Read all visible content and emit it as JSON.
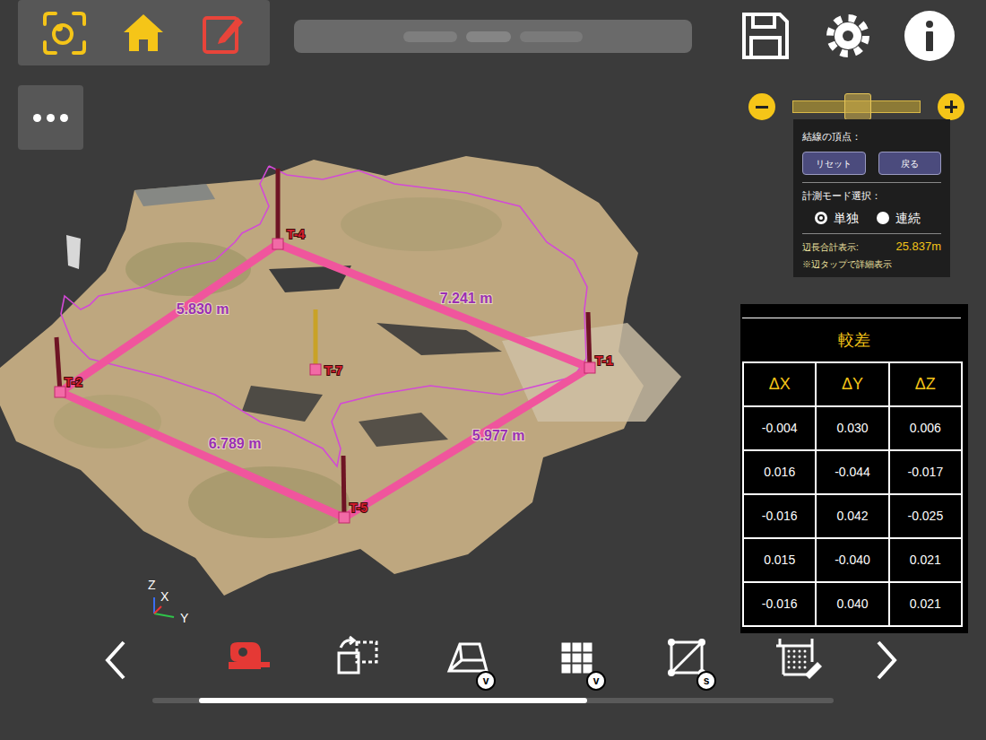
{
  "zoom": {
    "level": 0.5
  },
  "panel": {
    "vertex_label": "結線の頂点：",
    "buttons": [
      "リセット",
      "戻る"
    ],
    "mode_label": "計測モード選択：",
    "modes": [
      {
        "label": "単独",
        "selected": true
      },
      {
        "label": "連続",
        "selected": false
      }
    ],
    "total_label": "辺長合計表示:",
    "total_value": "25.837m",
    "note": "※辺タップで詳細表示"
  },
  "diff_table": {
    "title": "較差",
    "columns": [
      "ΔX",
      "ΔY",
      "ΔZ"
    ],
    "rows": [
      [
        "-0.004",
        "0.030",
        "0.006"
      ],
      [
        "0.016",
        "-0.044",
        "-0.017"
      ],
      [
        "-0.016",
        "0.042",
        "-0.025"
      ],
      [
        "0.015",
        "-0.040",
        "0.021"
      ],
      [
        "-0.016",
        "0.040",
        "0.021"
      ]
    ]
  },
  "scene": {
    "points": [
      {
        "label": "T-4",
        "color": "#6e1424"
      },
      {
        "label": "T-1",
        "color": "#6e1424"
      },
      {
        "label": "T-5",
        "color": "#6e1424"
      },
      {
        "label": "T-2",
        "color": "#6e1424"
      },
      {
        "label": "T-7",
        "color": "#c9a227"
      }
    ],
    "edges": [
      {
        "length": "7.241 m"
      },
      {
        "length": "5.977 m"
      },
      {
        "length": "6.789 m"
      },
      {
        "length": "5.830 m"
      }
    ],
    "axes": [
      "Z",
      "X",
      "Y"
    ]
  },
  "bottom_tools": [
    {
      "kind": "tape",
      "selected": true
    },
    {
      "kind": "rotate",
      "selected": false
    },
    {
      "kind": "frame",
      "selected": false,
      "badge": "v"
    },
    {
      "kind": "voxel",
      "selected": false,
      "badge": "v"
    },
    {
      "kind": "diagonal",
      "selected": false,
      "badge": "s"
    },
    {
      "kind": "grid",
      "selected": false
    }
  ],
  "scrollbar": {
    "level": 0.57
  }
}
